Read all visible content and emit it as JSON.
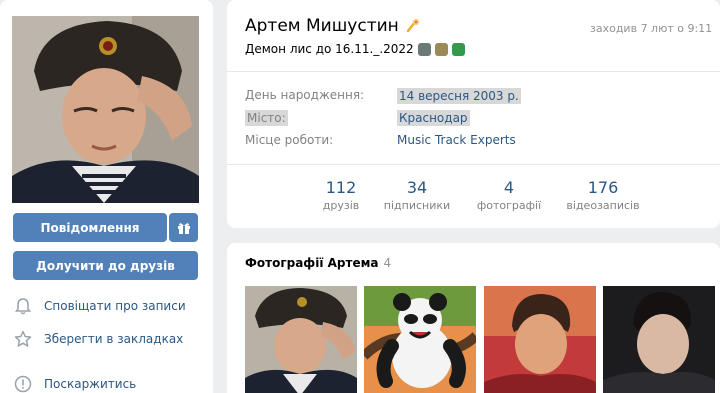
{
  "profile": {
    "name": "Артем Мишустин",
    "status": "Демон лис до 16.11._.2022",
    "last_seen": "заходив 7 лют о 9:11"
  },
  "actions": {
    "message": "Повідомлення",
    "add_friend": "Долучити до друзів",
    "notify": "Сповіщати про записи",
    "bookmark": "Зберегти в закладках",
    "report": "Поскаржитись"
  },
  "info": [
    {
      "label": "День народження:",
      "value": "14 вересня 2003 р."
    },
    {
      "label": "Місто:",
      "value": "Краснодар"
    },
    {
      "label": "Місце роботи:",
      "value": "Music Track Experts"
    }
  ],
  "counters": [
    {
      "num": "112",
      "cap": "друзів"
    },
    {
      "num": "34",
      "cap": "підписники"
    },
    {
      "num": "4",
      "cap": "фотографії"
    },
    {
      "num": "176",
      "cap": "відеозаписів"
    }
  ],
  "photos": {
    "title": "Фотографії Артема",
    "count": "4"
  },
  "colors": {
    "accent": "#5181b8",
    "link": "#2a5885",
    "background": "#edeef0"
  }
}
